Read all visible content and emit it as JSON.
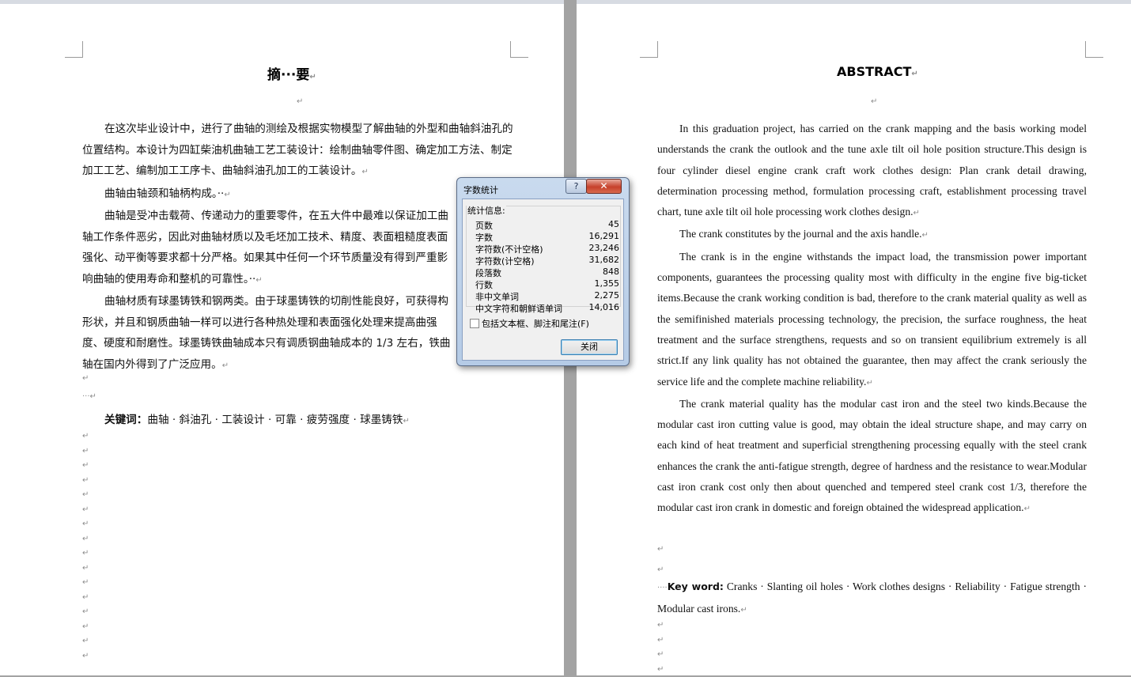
{
  "left_page": {
    "title": "摘···要",
    "paragraphs": [
      "在这次毕业设计中，进行了曲轴的测绘及根据实物模型了解曲轴的外型和曲轴斜油孔的位置结构。本设计为四缸柴油机曲轴工艺工装设计：绘制曲轴零件图、确定加工方法、制定加工工艺、编制加工工序卡、曲轴斜油孔加工的工装设计。",
      "曲轴由轴颈和轴柄构成。··",
      "曲轴是受冲击载荷、传递动力的重要零件，在五大件中最难以保证加工曲轴工作条件恶劣，因此对曲轴材质以及毛坯加工技术、精度、表面粗糙度表面强化、动平衡等要求都十分严格。如果其中任何一个环节质量没有得到严重影响曲轴的使用寿命和整机的可靠性。··",
      "曲轴材质有球墨铸铁和钢两类。由于球墨铸铁的切削性能良好，可获得构形状，并且和钢质曲轴一样可以进行各种热处理和表面强化处理来提高曲强度、硬度和耐磨性。球墨铸铁曲轴成本只有调质钢曲轴成本的 1/3 左右，铁曲轴在国内外得到了广泛应用。"
    ],
    "keywords_label": "关键词：",
    "keywords": "曲轴 · 斜油孔 · 工装设计 · 可靠 · 疲劳强度 · 球墨铸铁",
    "dots_line": "···"
  },
  "right_page": {
    "title": "ABSTRACT",
    "paragraphs": [
      "In this graduation project, has carried on the crank mapping and the basis working model understands the crank the outlook and the tune axle tilt oil hole position structure.This design is four cylinder diesel engine crank craft work clothes design: Plan crank detail drawing, determination processing method, formulation processing craft, establishment processing travel chart, tune axle tilt oil hole processing work clothes design.",
      "The crank constitutes by the journal and the axis handle.",
      "The crank is in the engine withstands the impact load, the transmission power important components, guarantees the processing quality most with difficulty in the engine five big-ticket items.Because the crank working condition is bad, therefore to the crank material quality as well as the semifinished materials processing technology, the precision, the surface roughness, the heat treatment and the surface strengthens, requests and so on transient equilibrium extremely is all strict.If any link quality has not obtained the guarantee, then may affect the crank seriously the service life and the complete machine reliability.",
      "The crank material quality has the modular cast iron and the steel two kinds.Because the modular cast iron cutting value is good, may obtain the ideal structure shape, and may carry on each kind of heat treatment and superficial strengthening processing equally with the steel crank enhances the crank the anti-fatigue strength, degree of hardness and the resistance to wear.Modular cast iron crank cost only then about quenched and tempered steel crank cost 1/3, therefore the modular cast iron crank in domestic and foreign obtained the widespread application."
    ],
    "keywords_label": "Key word:",
    "keywords": "Cranks · Slanting oil holes · Work clothes designs · Reliability · Fatigue strength · Modular cast irons.",
    "dots_line": "····"
  },
  "marks": {
    "paragraph": "↵"
  },
  "dialog": {
    "title": "字数统计",
    "help_label": "?",
    "close_x": "✕",
    "group_label": "统计信息:",
    "stats": [
      {
        "label": "页数",
        "value": "45"
      },
      {
        "label": "字数",
        "value": "16,291"
      },
      {
        "label": "字符数(不计空格)",
        "value": "23,246"
      },
      {
        "label": "字符数(计空格)",
        "value": "31,682"
      },
      {
        "label": "段落数",
        "value": "848"
      },
      {
        "label": "行数",
        "value": "1,355"
      },
      {
        "label": "非中文单词",
        "value": "2,275"
      },
      {
        "label": "中文字符和朝鲜语单词",
        "value": "14,016"
      }
    ],
    "checkbox_label": "包括文本框、脚注和尾注(F)",
    "checkbox_checked": false,
    "close_button": "关闭"
  }
}
